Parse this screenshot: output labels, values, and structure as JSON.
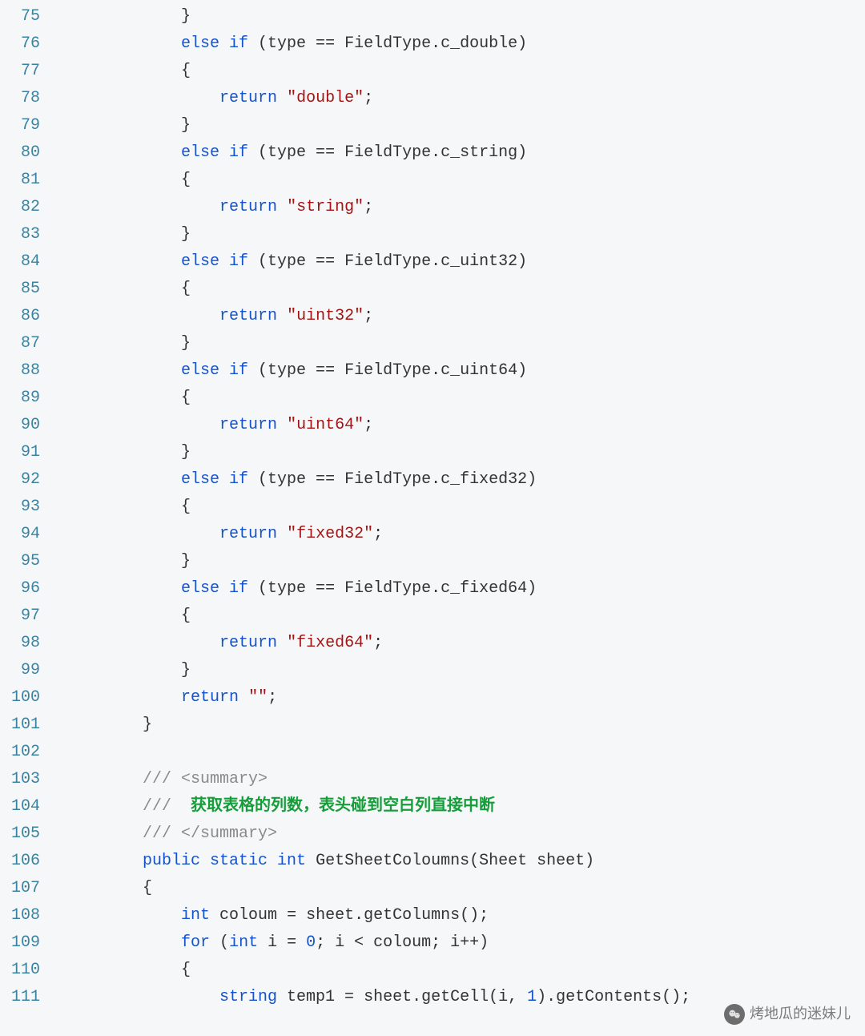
{
  "startLine": 75,
  "lines": [
    [
      {
        "c": "pl",
        "t": "            }"
      }
    ],
    [
      {
        "c": "pl",
        "t": "            "
      },
      {
        "c": "kw",
        "t": "else if"
      },
      {
        "c": "pl",
        "t": " (type == FieldType.c_double)"
      }
    ],
    [
      {
        "c": "pl",
        "t": "            {"
      }
    ],
    [
      {
        "c": "pl",
        "t": "                "
      },
      {
        "c": "kw",
        "t": "return"
      },
      {
        "c": "pl",
        "t": " "
      },
      {
        "c": "str",
        "t": "\"double\""
      },
      {
        "c": "pl",
        "t": ";"
      }
    ],
    [
      {
        "c": "pl",
        "t": "            }"
      }
    ],
    [
      {
        "c": "pl",
        "t": "            "
      },
      {
        "c": "kw",
        "t": "else if"
      },
      {
        "c": "pl",
        "t": " (type == FieldType.c_string)"
      }
    ],
    [
      {
        "c": "pl",
        "t": "            {"
      }
    ],
    [
      {
        "c": "pl",
        "t": "                "
      },
      {
        "c": "kw",
        "t": "return"
      },
      {
        "c": "pl",
        "t": " "
      },
      {
        "c": "str",
        "t": "\"string\""
      },
      {
        "c": "pl",
        "t": ";"
      }
    ],
    [
      {
        "c": "pl",
        "t": "            }"
      }
    ],
    [
      {
        "c": "pl",
        "t": "            "
      },
      {
        "c": "kw",
        "t": "else if"
      },
      {
        "c": "pl",
        "t": " (type == FieldType.c_uint32)"
      }
    ],
    [
      {
        "c": "pl",
        "t": "            {"
      }
    ],
    [
      {
        "c": "pl",
        "t": "                "
      },
      {
        "c": "kw",
        "t": "return"
      },
      {
        "c": "pl",
        "t": " "
      },
      {
        "c": "str",
        "t": "\"uint32\""
      },
      {
        "c": "pl",
        "t": ";"
      }
    ],
    [
      {
        "c": "pl",
        "t": "            }"
      }
    ],
    [
      {
        "c": "pl",
        "t": "            "
      },
      {
        "c": "kw",
        "t": "else if"
      },
      {
        "c": "pl",
        "t": " (type == FieldType.c_uint64)"
      }
    ],
    [
      {
        "c": "pl",
        "t": "            {"
      }
    ],
    [
      {
        "c": "pl",
        "t": "                "
      },
      {
        "c": "kw",
        "t": "return"
      },
      {
        "c": "pl",
        "t": " "
      },
      {
        "c": "str",
        "t": "\"uint64\""
      },
      {
        "c": "pl",
        "t": ";"
      }
    ],
    [
      {
        "c": "pl",
        "t": "            }"
      }
    ],
    [
      {
        "c": "pl",
        "t": "            "
      },
      {
        "c": "kw",
        "t": "else if"
      },
      {
        "c": "pl",
        "t": " (type == FieldType.c_fixed32)"
      }
    ],
    [
      {
        "c": "pl",
        "t": "            {"
      }
    ],
    [
      {
        "c": "pl",
        "t": "                "
      },
      {
        "c": "kw",
        "t": "return"
      },
      {
        "c": "pl",
        "t": " "
      },
      {
        "c": "str",
        "t": "\"fixed32\""
      },
      {
        "c": "pl",
        "t": ";"
      }
    ],
    [
      {
        "c": "pl",
        "t": "            }"
      }
    ],
    [
      {
        "c": "pl",
        "t": "            "
      },
      {
        "c": "kw",
        "t": "else if"
      },
      {
        "c": "pl",
        "t": " (type == FieldType.c_fixed64)"
      }
    ],
    [
      {
        "c": "pl",
        "t": "            {"
      }
    ],
    [
      {
        "c": "pl",
        "t": "                "
      },
      {
        "c": "kw",
        "t": "return"
      },
      {
        "c": "pl",
        "t": " "
      },
      {
        "c": "str",
        "t": "\"fixed64\""
      },
      {
        "c": "pl",
        "t": ";"
      }
    ],
    [
      {
        "c": "pl",
        "t": "            }"
      }
    ],
    [
      {
        "c": "pl",
        "t": "            "
      },
      {
        "c": "kw",
        "t": "return"
      },
      {
        "c": "pl",
        "t": " "
      },
      {
        "c": "str",
        "t": "\"\""
      },
      {
        "c": "pl",
        "t": ";"
      }
    ],
    [
      {
        "c": "pl",
        "t": "        }"
      }
    ],
    [],
    [
      {
        "c": "pl",
        "t": "        "
      },
      {
        "c": "doc",
        "t": "/// "
      },
      {
        "c": "docxml",
        "t": "<summary>"
      }
    ],
    [
      {
        "c": "pl",
        "t": "        "
      },
      {
        "c": "doc",
        "t": "/// "
      },
      {
        "c": "doctxt",
        "t": " 获取表格的列数，表头碰到空白列直接中断"
      }
    ],
    [
      {
        "c": "pl",
        "t": "        "
      },
      {
        "c": "doc",
        "t": "/// "
      },
      {
        "c": "docxml",
        "t": "</summary>"
      }
    ],
    [
      {
        "c": "pl",
        "t": "        "
      },
      {
        "c": "kw",
        "t": "public static int"
      },
      {
        "c": "pl",
        "t": " GetSheetColoumns(Sheet sheet)"
      }
    ],
    [
      {
        "c": "pl",
        "t": "        {"
      }
    ],
    [
      {
        "c": "pl",
        "t": "            "
      },
      {
        "c": "kw",
        "t": "int"
      },
      {
        "c": "pl",
        "t": " coloum = sheet.getColumns();"
      }
    ],
    [
      {
        "c": "pl",
        "t": "            "
      },
      {
        "c": "kw",
        "t": "for"
      },
      {
        "c": "pl",
        "t": " ("
      },
      {
        "c": "kw",
        "t": "int"
      },
      {
        "c": "pl",
        "t": " i = "
      },
      {
        "c": "num",
        "t": "0"
      },
      {
        "c": "pl",
        "t": "; i < coloum; i++)"
      }
    ],
    [
      {
        "c": "pl",
        "t": "            {"
      }
    ],
    [
      {
        "c": "pl",
        "t": "                "
      },
      {
        "c": "kw",
        "t": "string"
      },
      {
        "c": "pl",
        "t": " temp1 = sheet.getCell(i, "
      },
      {
        "c": "num",
        "t": "1"
      },
      {
        "c": "pl",
        "t": ").getContents();"
      }
    ]
  ],
  "watermark": "烤地瓜的迷妹儿"
}
